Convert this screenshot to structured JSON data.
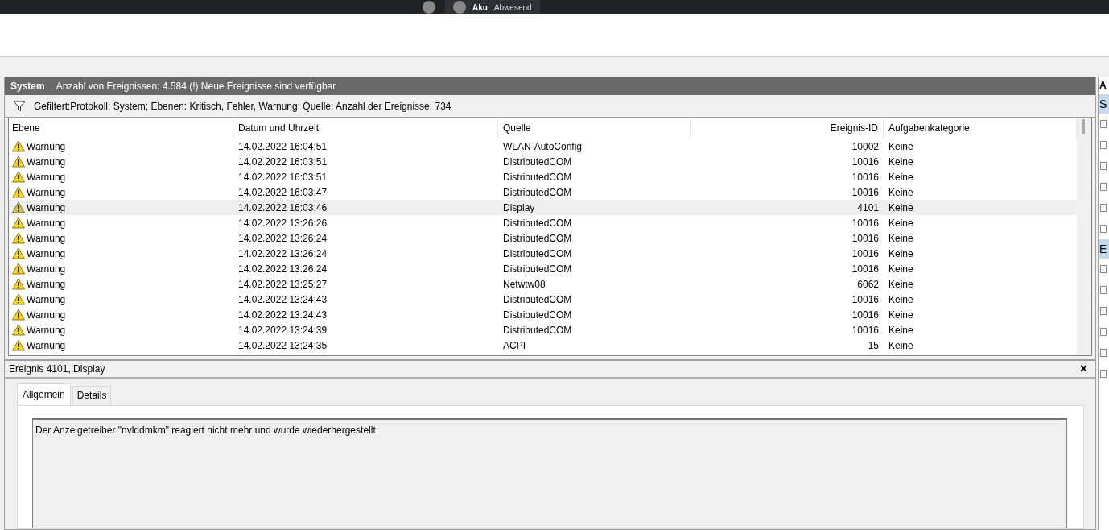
{
  "top_bar": {
    "contact_name": "Aku",
    "contact_status": "Abwesend"
  },
  "log_header": {
    "title": "System",
    "summary": "Anzahl von Ereignissen: 4.584 (!) Neue Ereignisse sind verfügbar"
  },
  "filter_bar": {
    "text": "Gefiltert:Protokoll: System; Ebenen: Kritisch, Fehler, Warnung; Quelle:  Anzahl der Ereignisse: 734"
  },
  "table": {
    "columns": [
      "Ebene",
      "Datum und Uhrzeit",
      "Quelle",
      "Ereignis-ID",
      "Aufgabenkategorie"
    ],
    "rows": [
      {
        "level": "Warnung",
        "date": "14.02.2022 16:04:51",
        "source": "WLAN-AutoConfig",
        "event_id": "10002",
        "category": "Keine",
        "selected": false
      },
      {
        "level": "Warnung",
        "date": "14.02.2022 16:03:51",
        "source": "DistributedCOM",
        "event_id": "10016",
        "category": "Keine",
        "selected": false
      },
      {
        "level": "Warnung",
        "date": "14.02.2022 16:03:51",
        "source": "DistributedCOM",
        "event_id": "10016",
        "category": "Keine",
        "selected": false
      },
      {
        "level": "Warnung",
        "date": "14.02.2022 16:03:47",
        "source": "DistributedCOM",
        "event_id": "10016",
        "category": "Keine",
        "selected": false
      },
      {
        "level": "Warnung",
        "date": "14.02.2022 16:03:46",
        "source": "Display",
        "event_id": "4101",
        "category": "Keine",
        "selected": true
      },
      {
        "level": "Warnung",
        "date": "14.02.2022 13:26:26",
        "source": "DistributedCOM",
        "event_id": "10016",
        "category": "Keine",
        "selected": false
      },
      {
        "level": "Warnung",
        "date": "14.02.2022 13:26:24",
        "source": "DistributedCOM",
        "event_id": "10016",
        "category": "Keine",
        "selected": false
      },
      {
        "level": "Warnung",
        "date": "14.02.2022 13:26:24",
        "source": "DistributedCOM",
        "event_id": "10016",
        "category": "Keine",
        "selected": false
      },
      {
        "level": "Warnung",
        "date": "14.02.2022 13:26:24",
        "source": "DistributedCOM",
        "event_id": "10016",
        "category": "Keine",
        "selected": false
      },
      {
        "level": "Warnung",
        "date": "14.02.2022 13:25:27",
        "source": "Netwtw08",
        "event_id": "6062",
        "category": "Keine",
        "selected": false
      },
      {
        "level": "Warnung",
        "date": "14.02.2022 13:24:43",
        "source": "DistributedCOM",
        "event_id": "10016",
        "category": "Keine",
        "selected": false
      },
      {
        "level": "Warnung",
        "date": "14.02.2022 13:24:43",
        "source": "DistributedCOM",
        "event_id": "10016",
        "category": "Keine",
        "selected": false
      },
      {
        "level": "Warnung",
        "date": "14.02.2022 13:24:39",
        "source": "DistributedCOM",
        "event_id": "10016",
        "category": "Keine",
        "selected": false
      },
      {
        "level": "Warnung",
        "date": "14.02.2022 13:24:35",
        "source": "ACPI",
        "event_id": "15",
        "category": "Keine",
        "selected": false
      }
    ]
  },
  "detail": {
    "title": "Ereignis 4101, Display",
    "close": "×",
    "tabs": [
      {
        "label": "Allgemein",
        "selected": true
      },
      {
        "label": "Details",
        "selected": false
      }
    ],
    "message": "Der Anzeigetreiber \"nvlddmkm\" reagiert nicht mehr und wurde wiederhergestellt."
  },
  "actions_pane": {
    "header": "A",
    "sections": [
      {
        "title": "S"
      },
      {
        "title": "E"
      }
    ]
  }
}
